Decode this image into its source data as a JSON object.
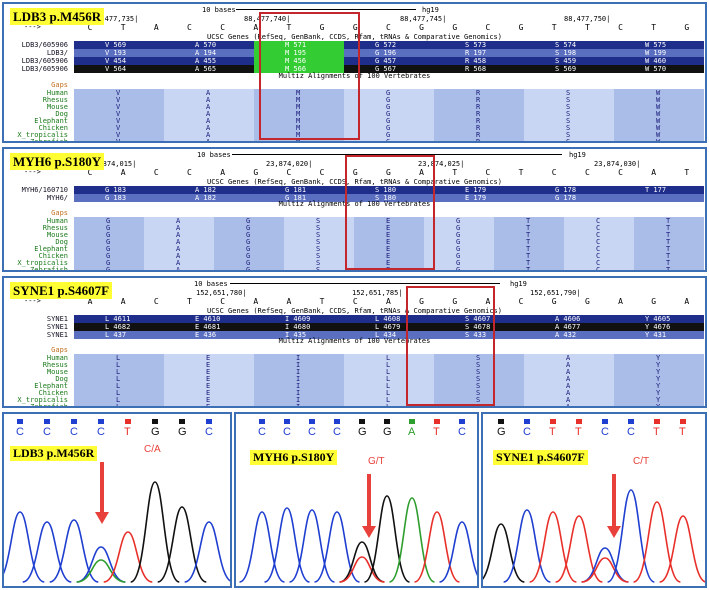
{
  "panels": [
    {
      "gene_label": "LDB3 p.M456R",
      "scale_text": "10 bases",
      "assembly": "hg19",
      "coords": [
        "88,477,735|",
        "88,477,740|",
        "88,477,745|",
        "88,477,750|"
      ],
      "seq": [
        "C",
        "T",
        "A",
        "C",
        "C",
        "A",
        "T",
        "G",
        "G",
        "C",
        "G",
        "G",
        "C",
        "G",
        "T",
        "T",
        "C",
        "T",
        "G"
      ],
      "genes_title": "UCSC Genes (RefSeq, GenBank, CCDS, Rfam, tRNAs & Comparative Genomics)",
      "tracks": [
        {
          "name": "LDB3/605906",
          "codons": [
            "V 569",
            "A 570",
            "M 571",
            "G 572",
            "S 573",
            "S 574",
            "W 575"
          ]
        },
        {
          "name": "LDB3/",
          "codons": [
            "V 193",
            "A 194",
            "M 195",
            "G 196",
            "R 197",
            "S 198",
            "W 199"
          ]
        },
        {
          "name": "LDB3/605906",
          "codons": [
            "V 454",
            "A 455",
            "M 456",
            "G 457",
            "R 458",
            "S 459",
            "W 460"
          ]
        },
        {
          "name": "LDB3/605906",
          "codons": [
            "V 564",
            "A 565",
            "M 566",
            "G 567",
            "R 568",
            "S 569",
            "W 570"
          ]
        }
      ],
      "multiz_title": "Multiz Alignments of 100 Vertebrates",
      "gaps_label": "Gaps",
      "species": [
        "Human",
        "Rhesus",
        "Mouse",
        "Dog",
        "Elephant",
        "Chicken",
        "X_tropicalis",
        "Zebrafish"
      ],
      "aa": [
        "V",
        "A",
        "M",
        "G",
        "R",
        "S",
        "W"
      ]
    },
    {
      "gene_label": "MYH6 p.S180Y",
      "scale_text": "10 bases",
      "assembly": "hg19",
      "coords": [
        "23,874,015|",
        "23,874,020|",
        "23,874,025|",
        "23,874,030|"
      ],
      "seq": [
        "C",
        "A",
        "C",
        "C",
        "A",
        "G",
        "C",
        "C",
        "G",
        "G",
        "A",
        "T",
        "C",
        "T",
        "C",
        "C",
        "C",
        "A",
        "T"
      ],
      "genes_title": "UCSC Genes (RefSeq, GenBank, CCDS, Rfam, tRNAs & Comparative Genomics)",
      "tracks": [
        {
          "name": "MYH6/160710",
          "codons": [
            "G 183",
            "A 182",
            "G 181",
            "S 180",
            "E 179",
            "G 178",
            "T 177"
          ]
        },
        {
          "name": "MYH6/",
          "codons": [
            "G 183",
            "A 182",
            "G 181",
            "S 180",
            "E 179",
            "G 178",
            ""
          ]
        }
      ],
      "multiz_title": "Multiz Alignments of 100 Vertebrates",
      "gaps_label": "Gaps",
      "species": [
        "Human",
        "Rhesus",
        "Mouse",
        "Dog",
        "Elephant",
        "Chicken",
        "X_tropicalis",
        "Zebrafish"
      ],
      "aa": [
        "G",
        "A",
        "G",
        "S",
        "E",
        "G",
        "T",
        "C",
        "T"
      ]
    },
    {
      "gene_label": "SYNE1 p.S4607F",
      "scale_text": "10 bases",
      "assembly": "hg19",
      "coords": [
        "152,651,780|",
        "152,651,785|",
        "152,651,790|"
      ],
      "seq": [
        "A",
        "A",
        "C",
        "T",
        "C",
        "A",
        "A",
        "T",
        "C",
        "A",
        "G",
        "G",
        "A",
        "C",
        "G",
        "G",
        "A",
        "G",
        "A"
      ],
      "genes_title": "UCSC Genes (RefSeq, GenBank, CCDS, Rfam, tRNAs & Comparative Genomics)",
      "tracks": [
        {
          "name": "SYNE1",
          "codons": [
            "L 4611",
            "E 4610",
            "I 4609",
            "L 4608",
            "S 4607",
            "A 4606",
            "Y 4605"
          ]
        },
        {
          "name": "SYNE1",
          "codons": [
            "L 4682",
            "E 4681",
            "I 4680",
            "L 4679",
            "S 4678",
            "A 4677",
            "Y 4676"
          ]
        },
        {
          "name": "SYNE1",
          "codons": [
            "L 437",
            "E 436",
            "I 435",
            "L 434",
            "S 433",
            "A 432",
            "Y 431"
          ]
        }
      ],
      "multiz_title": "Multiz Alignments of 100 Vertebrates",
      "gaps_label": "Gaps",
      "species": [
        "Human",
        "Rhesus",
        "Mouse",
        "Dog",
        "Elephant",
        "Chicken",
        "X_tropicalis",
        "Zebrafish"
      ],
      "aa": [
        "L",
        "E",
        "I",
        "L",
        "S",
        "A",
        "Y"
      ]
    }
  ],
  "chromatograms": [
    {
      "label": "LDB3 p.M456R",
      "mutation": "C/A",
      "bases": [
        "C",
        "C",
        "C",
        "C",
        "T",
        "G",
        "G",
        "C"
      ]
    },
    {
      "label": "MYH6 p.S180Y",
      "mutation": "G/T",
      "bases": [
        "C",
        "C",
        "C",
        "C",
        "G",
        "G",
        "A",
        "T",
        "C"
      ]
    },
    {
      "label": "SYNE1 p.S4607F",
      "mutation": "C/T",
      "bases": [
        "G",
        "C",
        "T",
        "T",
        "C",
        "C",
        "T",
        "T"
      ]
    }
  ],
  "colors": {
    "border": "#3d6fb4",
    "highlight": "#c3272b",
    "arrow": "#e8413b",
    "label_bg": "#ffff33",
    "track_dark": "#1f2e8a",
    "track_mid": "#5a6fc0",
    "track_black": "#111111",
    "mutant_green": "#33cc33",
    "multiz": "#a9bde8"
  }
}
